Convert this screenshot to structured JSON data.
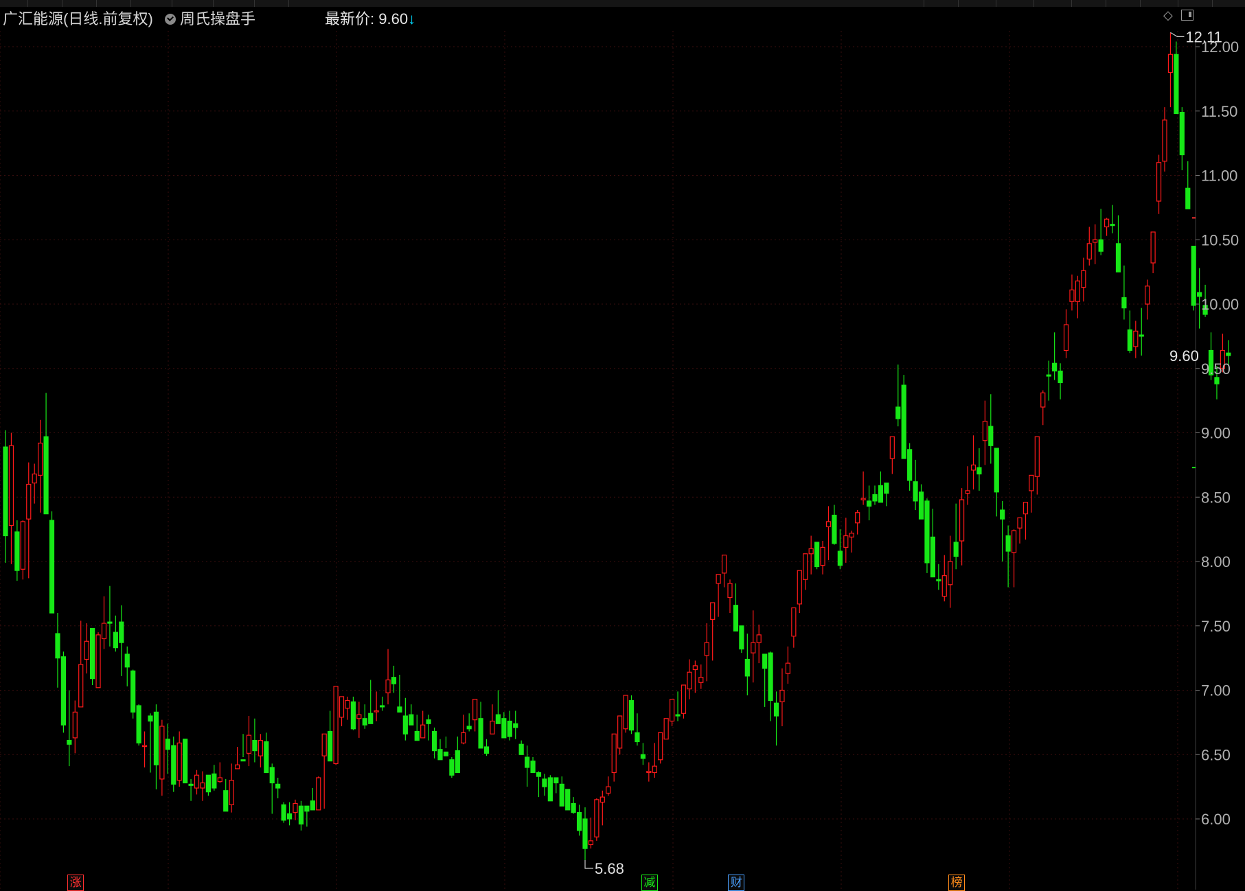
{
  "header": {
    "stock_title": "广汇能源(日线.前复权)",
    "indicator_name": "周氏操盘手",
    "latest_label": "最新价:",
    "latest_price": "9.60",
    "latest_arrow": "↓"
  },
  "colors": {
    "up": "#ff1a1a",
    "down": "#17e817",
    "grid": "#3a0e0e",
    "axis_text": "#b0b0b0",
    "background": "#000000"
  },
  "chart_data": {
    "type": "candlestick",
    "title": "广汇能源(日线.前复权)",
    "ylim": [
      5.55,
      12.25
    ],
    "y_ticks": [
      6.0,
      6.5,
      7.0,
      7.5,
      8.0,
      8.5,
      9.0,
      9.5,
      10.0,
      10.5,
      11.0,
      11.5,
      12.0
    ],
    "y_tick_labels": [
      "6.00",
      "6.50",
      "7.00",
      "7.50",
      "8.00",
      "8.50",
      "9.00",
      "9.50",
      "10.00",
      "10.50",
      "11.00",
      "11.50",
      "12.00"
    ],
    "grid": true,
    "annotations": {
      "high_label": "12.11",
      "low_label": "5.68",
      "last_label": "9.60"
    },
    "event_markers": [
      {
        "label": "涨",
        "color": "#ff3030",
        "bar": 12
      },
      {
        "label": "减",
        "color": "#17e817",
        "bar": 111
      },
      {
        "label": "财",
        "color": "#4aa0ff",
        "bar": 126
      },
      {
        "label": "榜",
        "color": "#ff8c1a",
        "bar": 164
      }
    ],
    "candles": [
      [
        8.89,
        9.02,
        7.99,
        8.2
      ],
      [
        8.28,
        9.0,
        7.98,
        8.9
      ],
      [
        8.23,
        8.32,
        7.85,
        7.93
      ],
      [
        7.94,
        8.32,
        7.86,
        8.31
      ],
      [
        8.33,
        8.77,
        7.87,
        8.6
      ],
      [
        8.61,
        8.76,
        8.45,
        8.68
      ],
      [
        8.67,
        9.1,
        8.38,
        8.92
      ],
      [
        8.97,
        9.31,
        8.8,
        8.37
      ],
      [
        8.32,
        8.39,
        7.61,
        7.6
      ],
      [
        7.44,
        7.6,
        7.02,
        7.25
      ],
      [
        7.26,
        7.3,
        6.67,
        6.73
      ],
      [
        6.61,
        7.0,
        6.41,
        6.58
      ],
      [
        6.63,
        6.92,
        6.51,
        6.83
      ],
      [
        6.87,
        7.54,
        6.92,
        7.2
      ],
      [
        7.24,
        7.52,
        7.13,
        7.38
      ],
      [
        7.48,
        7.48,
        7.04,
        7.09
      ],
      [
        7.02,
        7.45,
        7.03,
        7.43
      ],
      [
        7.4,
        7.73,
        7.32,
        7.52
      ],
      [
        7.53,
        7.81,
        7.34,
        7.52
      ],
      [
        7.45,
        7.58,
        7.3,
        7.33
      ],
      [
        7.53,
        7.66,
        7.11,
        7.37
      ],
      [
        7.28,
        7.34,
        7.03,
        7.18
      ],
      [
        7.15,
        7.16,
        6.78,
        6.83
      ],
      [
        6.88,
        6.89,
        6.57,
        6.59
      ],
      [
        6.57,
        6.68,
        6.4,
        6.57
      ],
      [
        6.8,
        6.82,
        6.36,
        6.76
      ],
      [
        6.83,
        6.89,
        6.23,
        6.42
      ],
      [
        6.31,
        6.77,
        6.18,
        6.72
      ],
      [
        6.62,
        6.74,
        6.35,
        6.54
      ],
      [
        6.57,
        6.64,
        6.21,
        6.27
      ],
      [
        6.3,
        6.68,
        6.25,
        6.59
      ],
      [
        6.62,
        6.61,
        6.3,
        6.28
      ],
      [
        6.27,
        6.31,
        6.14,
        6.26
      ],
      [
        6.24,
        6.38,
        6.19,
        6.34
      ],
      [
        6.24,
        6.37,
        6.14,
        6.28
      ],
      [
        6.34,
        6.28,
        6.18,
        6.21
      ],
      [
        6.35,
        6.42,
        6.22,
        6.24
      ],
      [
        6.29,
        6.44,
        6.28,
        6.32
      ],
      [
        6.22,
        6.31,
        6.09,
        6.06
      ],
      [
        6.11,
        6.43,
        6.05,
        6.3
      ],
      [
        6.39,
        6.56,
        6.41,
        6.42
      ],
      [
        6.46,
        6.66,
        6.48,
        6.45
      ],
      [
        6.51,
        6.8,
        6.41,
        6.65
      ],
      [
        6.61,
        6.78,
        6.44,
        6.53
      ],
      [
        6.49,
        6.66,
        6.4,
        6.61
      ],
      [
        6.6,
        6.67,
        6.41,
        6.36
      ],
      [
        6.4,
        6.43,
        6.04,
        6.28
      ],
      [
        6.27,
        6.32,
        6.16,
        6.24
      ],
      [
        6.11,
        6.13,
        5.97,
        5.99
      ],
      [
        6.04,
        6.13,
        5.95,
        6.0
      ],
      [
        6.05,
        6.15,
        5.99,
        6.12
      ],
      [
        6.1,
        6.14,
        5.91,
        5.96
      ],
      [
        6.1,
        6.1,
        5.94,
        6.06
      ],
      [
        6.14,
        6.24,
        6.1,
        6.07
      ],
      [
        6.07,
        6.33,
        6.09,
        6.32
      ],
      [
        6.49,
        6.59,
        6.08,
        6.66
      ],
      [
        6.68,
        6.84,
        6.48,
        6.45
      ],
      [
        6.43,
        7.0,
        6.42,
        7.03
      ],
      [
        6.79,
        6.95,
        6.72,
        6.95
      ],
      [
        6.86,
        6.95,
        6.77,
        6.92
      ],
      [
        6.91,
        6.95,
        6.69,
        6.7
      ],
      [
        6.78,
        6.91,
        6.63,
        6.81
      ],
      [
        6.78,
        6.89,
        6.7,
        6.73
      ],
      [
        6.82,
        7.08,
        6.82,
        6.74
      ],
      [
        6.84,
        6.99,
        6.76,
        6.84
      ],
      [
        6.88,
        6.95,
        6.84,
        6.87
      ],
      [
        6.98,
        7.32,
        6.89,
        7.08
      ],
      [
        7.1,
        7.19,
        6.98,
        7.05
      ],
      [
        6.87,
        7.12,
        6.87,
        6.83
      ],
      [
        6.8,
        6.94,
        6.61,
        6.66
      ],
      [
        6.81,
        6.89,
        6.75,
        6.73
      ],
      [
        6.68,
        6.81,
        6.65,
        6.61
      ],
      [
        6.63,
        6.84,
        6.63,
        6.73
      ],
      [
        6.77,
        6.81,
        6.61,
        6.74
      ],
      [
        6.68,
        6.71,
        6.47,
        6.53
      ],
      [
        6.54,
        6.62,
        6.49,
        6.46
      ],
      [
        6.52,
        6.64,
        6.55,
        6.49
      ],
      [
        6.46,
        6.48,
        6.32,
        6.34
      ],
      [
        6.53,
        6.64,
        6.45,
        6.36
      ],
      [
        6.59,
        6.81,
        6.58,
        6.67
      ],
      [
        6.72,
        6.82,
        6.68,
        6.7
      ],
      [
        6.77,
        6.92,
        6.68,
        6.93
      ],
      [
        6.78,
        6.91,
        6.66,
        6.55
      ],
      [
        6.56,
        6.62,
        6.49,
        6.51
      ],
      [
        6.66,
        6.89,
        6.68,
        6.76
      ],
      [
        6.81,
        7.0,
        6.81,
        6.74
      ],
      [
        6.78,
        6.83,
        6.65,
        6.63
      ],
      [
        6.76,
        6.84,
        6.61,
        6.64
      ],
      [
        6.74,
        6.84,
        6.62,
        6.71
      ],
      [
        6.58,
        6.61,
        6.53,
        6.5
      ],
      [
        6.48,
        6.57,
        6.25,
        6.4
      ],
      [
        6.45,
        6.48,
        6.38,
        6.36
      ],
      [
        6.36,
        6.37,
        6.17,
        6.33
      ],
      [
        6.31,
        6.35,
        6.18,
        6.25
      ],
      [
        6.32,
        6.34,
        6.19,
        6.14
      ],
      [
        6.32,
        6.31,
        6.2,
        6.28
      ],
      [
        6.27,
        6.33,
        6.12,
        6.1
      ],
      [
        6.23,
        6.21,
        6.1,
        6.07
      ],
      [
        6.12,
        6.17,
        6.04,
        6.05
      ],
      [
        6.05,
        6.11,
        5.87,
        5.91
      ],
      [
        6.0,
        6.09,
        5.68,
        5.77
      ],
      [
        5.8,
        6.01,
        5.77,
        5.83
      ],
      [
        5.86,
        6.16,
        5.83,
        6.15
      ],
      [
        6.13,
        6.22,
        5.95,
        6.17
      ],
      [
        6.2,
        6.33,
        6.18,
        6.25
      ],
      [
        6.36,
        6.58,
        6.29,
        6.66
      ],
      [
        6.55,
        6.79,
        6.5,
        6.8
      ],
      [
        6.7,
        6.93,
        6.67,
        6.96
      ],
      [
        6.92,
        6.96,
        6.66,
        6.69
      ],
      [
        6.67,
        6.82,
        6.57,
        6.6
      ],
      [
        6.5,
        6.59,
        6.42,
        6.47
      ],
      [
        6.36,
        6.44,
        6.29,
        6.37
      ],
      [
        6.36,
        6.59,
        6.32,
        6.41
      ],
      [
        6.46,
        6.65,
        6.43,
        6.67
      ],
      [
        6.62,
        6.76,
        6.65,
        6.78
      ],
      [
        6.76,
        6.84,
        6.72,
        6.93
      ],
      [
        6.81,
        6.99,
        6.76,
        6.8
      ],
      [
        6.82,
        7.02,
        6.78,
        7.04
      ],
      [
        7.01,
        7.24,
        6.93,
        7.14
      ],
      [
        7.16,
        7.23,
        6.98,
        7.19
      ],
      [
        7.06,
        7.2,
        7.01,
        7.1
      ],
      [
        7.27,
        7.52,
        7.07,
        7.37
      ],
      [
        7.55,
        7.68,
        7.23,
        7.68
      ],
      [
        7.83,
        7.87,
        7.57,
        7.9
      ],
      [
        7.91,
        8.05,
        7.8,
        8.05
      ],
      [
        7.72,
        7.86,
        7.6,
        7.83
      ],
      [
        7.66,
        7.83,
        7.48,
        7.46
      ],
      [
        7.5,
        7.48,
        7.29,
        7.32
      ],
      [
        7.24,
        7.44,
        6.96,
        7.11
      ],
      [
        7.29,
        7.62,
        7.06,
        7.37
      ],
      [
        7.37,
        7.51,
        7.21,
        7.43
      ],
      [
        7.28,
        7.28,
        6.87,
        7.17
      ],
      [
        7.29,
        7.3,
        6.76,
        6.92
      ],
      [
        6.9,
        6.99,
        6.57,
        6.8
      ],
      [
        6.91,
        7.17,
        6.72,
        7.0
      ],
      [
        7.13,
        7.34,
        7.05,
        7.21
      ],
      [
        7.42,
        7.61,
        7.33,
        7.64
      ],
      [
        7.67,
        7.88,
        7.6,
        7.93
      ],
      [
        7.86,
        7.99,
        7.78,
        8.06
      ],
      [
        8.06,
        8.2,
        7.9,
        8.1
      ],
      [
        8.15,
        8.15,
        7.94,
        7.96
      ],
      [
        7.97,
        8.16,
        7.9,
        8.11
      ],
      [
        8.27,
        8.43,
        8.01,
        8.31
      ],
      [
        8.36,
        8.44,
        8.13,
        8.14
      ],
      [
        8.08,
        8.25,
        7.94,
        7.97
      ],
      [
        8.11,
        8.34,
        7.99,
        8.2
      ],
      [
        8.19,
        8.24,
        8.07,
        8.22
      ],
      [
        8.3,
        8.4,
        8.21,
        8.38
      ],
      [
        8.48,
        8.7,
        8.44,
        8.49
      ],
      [
        8.47,
        8.59,
        8.32,
        8.43
      ],
      [
        8.52,
        8.59,
        8.44,
        8.47
      ],
      [
        8.59,
        8.7,
        8.49,
        8.46
      ],
      [
        8.61,
        8.6,
        8.43,
        8.53
      ],
      [
        8.8,
        8.93,
        8.68,
        8.97
      ],
      [
        9.2,
        9.53,
        9.05,
        9.11
      ],
      [
        9.37,
        9.45,
        8.82,
        8.8
      ],
      [
        8.87,
        8.92,
        8.55,
        8.63
      ],
      [
        8.62,
        8.79,
        8.4,
        8.47
      ],
      [
        8.54,
        8.6,
        8.36,
        8.33
      ],
      [
        8.47,
        8.49,
        7.91,
        7.99
      ],
      [
        8.19,
        8.41,
        7.89,
        7.88
      ],
      [
        7.86,
        7.98,
        7.78,
        7.85
      ],
      [
        7.73,
        8.05,
        7.69,
        7.89
      ],
      [
        7.82,
        8.2,
        7.64,
        8.0
      ],
      [
        8.15,
        8.45,
        7.94,
        8.04
      ],
      [
        8.16,
        8.57,
        7.97,
        8.48
      ],
      [
        8.53,
        8.74,
        8.44,
        8.55
      ],
      [
        8.71,
        8.98,
        8.56,
        8.75
      ],
      [
        8.73,
        8.88,
        8.55,
        8.68
      ],
      [
        8.94,
        9.25,
        8.75,
        9.09
      ],
      [
        9.05,
        9.3,
        8.76,
        8.9
      ],
      [
        8.88,
        8.86,
        8.35,
        8.54
      ],
      [
        8.4,
        8.47,
        8.0,
        8.33
      ],
      [
        8.2,
        8.28,
        7.8,
        8.08
      ],
      [
        8.07,
        8.25,
        7.8,
        8.24
      ],
      [
        8.26,
        8.31,
        8.14,
        8.34
      ],
      [
        8.37,
        8.45,
        8.17,
        8.46
      ],
      [
        8.55,
        8.63,
        8.38,
        8.67
      ],
      [
        8.66,
        8.82,
        8.52,
        8.97
      ],
      [
        9.2,
        9.33,
        9.06,
        9.31
      ],
      [
        9.45,
        9.56,
        9.25,
        9.44
      ],
      [
        9.54,
        9.78,
        9.41,
        9.48
      ],
      [
        9.48,
        9.54,
        9.26,
        9.39
      ],
      [
        9.64,
        9.96,
        9.58,
        9.84
      ],
      [
        10.02,
        10.23,
        9.95,
        10.11
      ],
      [
        10.02,
        10.22,
        9.89,
        10.18
      ],
      [
        10.13,
        10.36,
        10.02,
        10.26
      ],
      [
        10.35,
        10.6,
        10.3,
        10.47
      ],
      [
        10.48,
        10.62,
        10.31,
        10.5
      ],
      [
        10.5,
        10.74,
        10.38,
        10.41
      ],
      [
        10.6,
        10.67,
        10.53,
        10.66
      ],
      [
        10.62,
        10.77,
        10.55,
        10.61
      ],
      [
        10.47,
        10.69,
        10.27,
        10.25
      ],
      [
        10.05,
        10.3,
        9.88,
        9.97
      ],
      [
        9.8,
        9.95,
        9.62,
        9.64
      ],
      [
        9.67,
        9.87,
        9.58,
        9.79
      ],
      [
        9.76,
        9.97,
        9.6,
        9.75
      ],
      [
        10.0,
        10.19,
        9.88,
        10.14
      ],
      [
        10.32,
        10.55,
        10.24,
        10.56
      ],
      [
        10.8,
        11.16,
        10.7,
        11.1
      ],
      [
        11.11,
        11.53,
        11.03,
        11.43
      ],
      [
        11.8,
        12.11,
        11.53,
        11.94
      ],
      [
        11.94,
        12.04,
        11.52,
        11.48
      ],
      [
        11.49,
        11.53,
        11.04,
        11.16
      ],
      [
        10.9,
        11.11,
        10.77,
        10.74
      ],
      [
        10.45,
        10.37,
        9.95,
        9.99
      ],
      [
        10.09,
        10.28,
        9.81,
        10.06
      ],
      [
        9.99,
        10.15,
        9.9,
        9.92
      ],
      [
        9.64,
        9.78,
        9.41,
        9.45
      ],
      [
        9.43,
        9.52,
        9.26,
        9.38
      ],
      [
        9.5,
        9.77,
        9.47,
        9.64
      ],
      [
        9.62,
        9.72,
        9.53,
        9.6
      ]
    ]
  }
}
